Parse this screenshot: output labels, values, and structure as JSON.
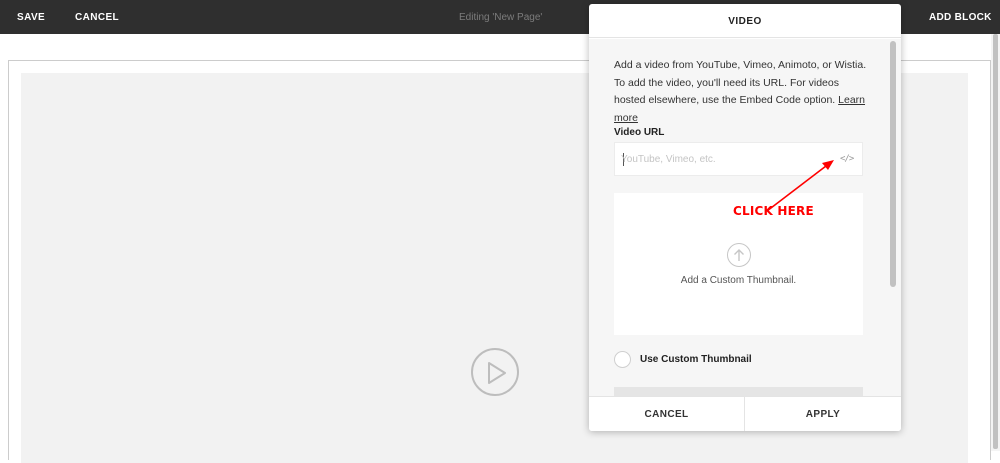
{
  "topbar": {
    "save_label": "SAVE",
    "cancel_label": "CANCEL",
    "editing_title": "Editing 'New Page'",
    "add_block_label": "ADD BLOCK"
  },
  "dialog": {
    "title": "VIDEO",
    "description": "Add a video from YouTube, Vimeo, Animoto, or Wistia. To add the video, you'll need its URL. For videos hosted elsewhere, use the Embed Code option.",
    "learn_more": "Learn more",
    "url_label": "Video URL",
    "url_placeholder": "YouTube, Vimeo, etc.",
    "url_value": "",
    "code_icon_glyph": "</>",
    "thumbnail_text": "Add a Custom Thumbnail.",
    "use_custom_thumbnail_label": "Use Custom Thumbnail",
    "use_custom_thumbnail_checked": false,
    "cancel_label": "CANCEL",
    "apply_label": "APPLY"
  },
  "annotation": {
    "text": "CLICK HERE",
    "color": "#ff0000"
  },
  "icons": {
    "play": "play-circle-icon",
    "upload": "upload-arrow-icon",
    "embed": "code-icon"
  }
}
